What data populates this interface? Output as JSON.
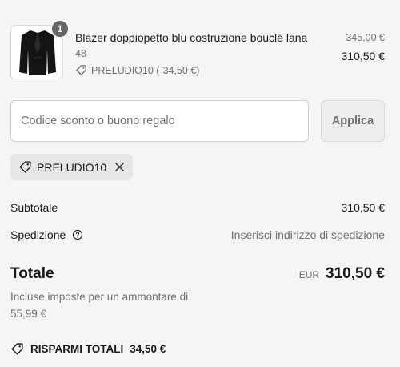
{
  "item": {
    "quantity": "1",
    "title": "Blazer doppiopetto blu costruzione bouclé lana",
    "variant": "48",
    "discount": "PRELUDIO10 (-34,50 €)",
    "price_original": "345,00 €",
    "price_final": "310,50 €",
    "thumbnail_icon": "jacket-thumbnail"
  },
  "discount_form": {
    "placeholder": "Codice sconto o buono regalo",
    "value": "",
    "apply_label": "Applica"
  },
  "applied_code": {
    "code": "PRELUDIO10",
    "tag_icon": "tag-icon",
    "remove_icon": "close-icon"
  },
  "summary": {
    "subtotal_label": "Subtotale",
    "subtotal_value": "310,50 €",
    "shipping_label": "Spedizione",
    "shipping_icon": "help-circle-icon",
    "shipping_value": "Inserisci indirizzo di spedizione",
    "total_label": "Totale",
    "currency": "EUR",
    "total_value": "310,50 €",
    "tax_note": "Incluse imposte per un ammontare di 55,99 €",
    "savings_label": "RISPARMI TOTALI",
    "savings_value": "34,50 €"
  },
  "colors": {
    "background": "#f5f5f5",
    "badge": "#666666",
    "muted_text": "#707070"
  }
}
